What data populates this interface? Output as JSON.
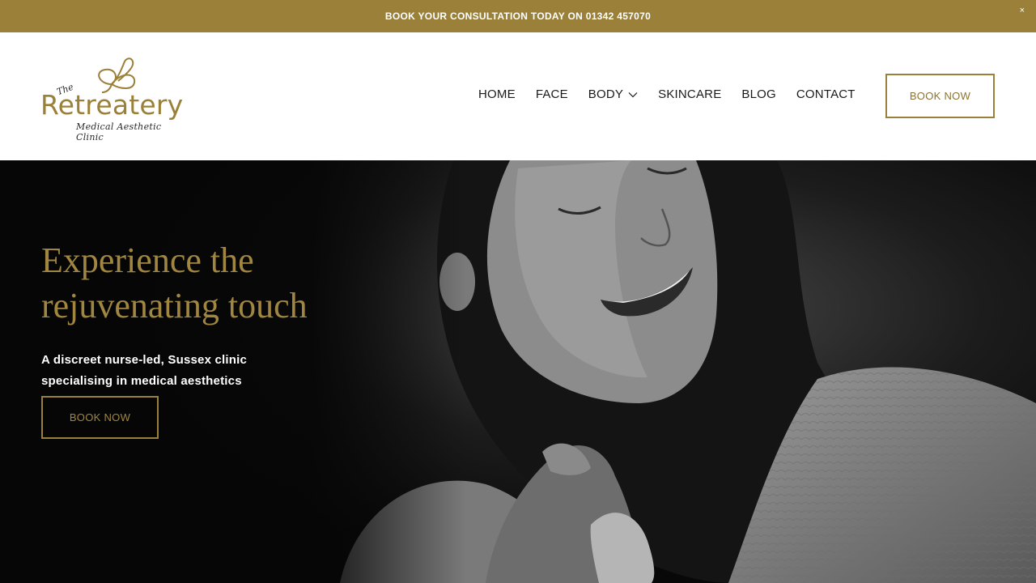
{
  "announcement": {
    "text": "BOOK YOUR CONSULTATION TODAY ON 01342 457070",
    "close": "×"
  },
  "logo": {
    "the": "The",
    "name": "Retreatery",
    "subtitle": "Medical Aesthetic Clinic"
  },
  "nav": {
    "items": [
      {
        "label": "HOME"
      },
      {
        "label": "FACE"
      },
      {
        "label": "BODY",
        "has_dropdown": true,
        "icon": "chevron-down-icon"
      },
      {
        "label": "SKINCARE"
      },
      {
        "label": "BLOG"
      },
      {
        "label": "CONTACT"
      }
    ],
    "book_label": "BOOK NOW"
  },
  "hero": {
    "title_line1": "Experience the",
    "title_line2": "rejuvenating touch",
    "subtitle_line1": "A discreet nurse-led, Sussex clinic",
    "subtitle_line2": "specialising in medical aesthetics",
    "book_label": "BOOK NOW",
    "image": "black-and-white-smiling-woman-photo"
  },
  "colors": {
    "accent": "#9a8038",
    "header_bg": "#ffffff",
    "hero_bg": "#070707",
    "nav_text": "#1a1a1a"
  }
}
